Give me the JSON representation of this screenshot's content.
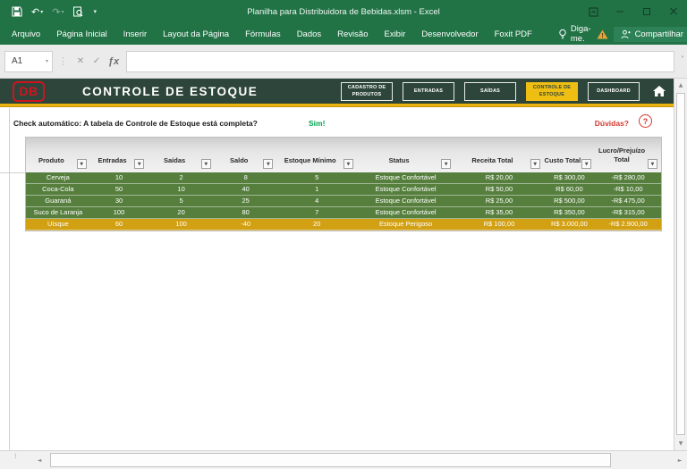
{
  "titlebar": {
    "title": "Planilha para Distribuidora de Bebidas.xlsm - Excel"
  },
  "ribbon": {
    "tabs": [
      "Arquivo",
      "Página Inicial",
      "Inserir",
      "Layout da Página",
      "Fórmulas",
      "Dados",
      "Revisão",
      "Exibir",
      "Desenvolvedor",
      "Foxit PDF"
    ],
    "tell_me": "Diga-me.",
    "share": "Compartilhar"
  },
  "formula_bar": {
    "name_box": "A1",
    "value": "",
    "fx_label": "ƒx"
  },
  "banner": {
    "logo_text": "DB",
    "title": "CONTROLE DE ESTOQUE",
    "nav": [
      {
        "label": "CADASTRO DE PRODUTOS",
        "active": false
      },
      {
        "label": "ENTRADAS",
        "active": false
      },
      {
        "label": "SAÍDAS",
        "active": false
      },
      {
        "label": "CONTROLE DE ESTOQUE",
        "active": true
      },
      {
        "label": "DASHBOARD",
        "active": false
      }
    ]
  },
  "check_row": {
    "question": "Check automático: A tabela de Controle de Estoque está completa?",
    "answer": "Sim!",
    "help_label": "Dúvidas?"
  },
  "table": {
    "columns": [
      "Produto",
      "Entradas",
      "Saídas",
      "Saldo",
      "Estoque Mínimo",
      "Status",
      "Receita Total",
      "Custo Total",
      "Lucro/Prejuízo Total"
    ],
    "rows": [
      {
        "produto": "Cerveja",
        "entradas": "10",
        "saidas": "2",
        "saldo": "8",
        "minimo": "5",
        "status": "Estoque Confortável",
        "receita": "R$ 20,00",
        "custo": "R$ 300,00",
        "lucro": "-R$ 280,00",
        "tone": "ok"
      },
      {
        "produto": "Coca-Cola",
        "entradas": "50",
        "saidas": "10",
        "saldo": "40",
        "minimo": "1",
        "status": "Estoque Confortável",
        "receita": "R$ 50,00",
        "custo": "R$ 60,00",
        "lucro": "-R$ 10,00",
        "tone": "ok"
      },
      {
        "produto": "Guaraná",
        "entradas": "30",
        "saidas": "5",
        "saldo": "25",
        "minimo": "4",
        "status": "Estoque Confortável",
        "receita": "R$ 25,00",
        "custo": "R$ 500,00",
        "lucro": "-R$ 475,00",
        "tone": "ok"
      },
      {
        "produto": "Suco de Laranja",
        "entradas": "100",
        "saidas": "20",
        "saldo": "80",
        "minimo": "7",
        "status": "Estoque Confortável",
        "receita": "R$ 35,00",
        "custo": "R$ 350,00",
        "lucro": "-R$ 315,00",
        "tone": "ok"
      },
      {
        "produto": "Uísque",
        "entradas": "60",
        "saidas": "100",
        "saldo": "-40",
        "minimo": "20",
        "status": "Estoque Perigoso",
        "receita": "R$ 100,00",
        "custo": "R$ 3.000,00",
        "lucro": "-R$ 2.900,00",
        "tone": "danger"
      }
    ]
  },
  "glyphs": {
    "filter_arrow": "▼",
    "undo": "↶",
    "redo": "↷",
    "qat_caret": "▾",
    "name_caret": "▾",
    "cancel": "✕",
    "enter": "✓",
    "expand": "˅",
    "minimize": "─",
    "close": "×",
    "question": "?",
    "scroll_up": "▲",
    "scroll_down": "▼",
    "scroll_left": "◄",
    "scroll_right": "►",
    "dots": "⁞"
  },
  "colors": {
    "excel_green": "#217346",
    "banner_green": "#2d453b",
    "accent_yellow": "#e9b411",
    "active_button_yellow": "#eebe13",
    "row_green": "#567f3e",
    "row_gold": "#d2a013",
    "alert_red": "#d23a2e",
    "logo_red": "#cf1420",
    "ok_green": "#00a64f"
  }
}
